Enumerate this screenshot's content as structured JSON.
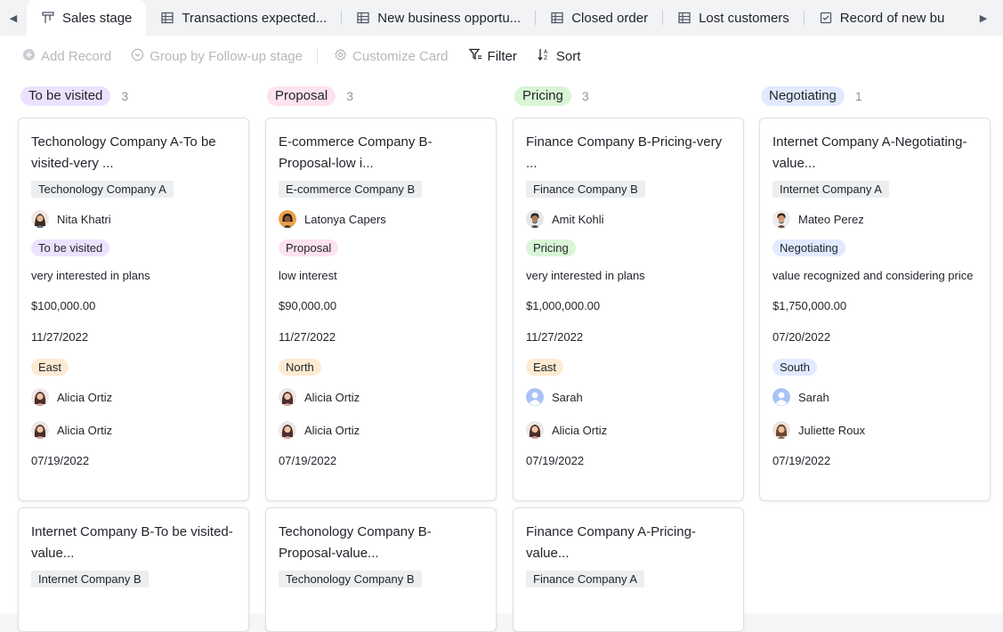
{
  "tabs": [
    {
      "label": "Sales stage",
      "icon": "kanban-icon",
      "active": true
    },
    {
      "label": "Transactions expected...",
      "icon": "grid-icon"
    },
    {
      "label": "New business opportu...",
      "icon": "grid-icon"
    },
    {
      "label": "Closed order",
      "icon": "grid-icon"
    },
    {
      "label": "Lost customers",
      "icon": "grid-icon"
    },
    {
      "label": "Record of new bu",
      "icon": "form-icon"
    }
  ],
  "toolbar": {
    "add_record": "Add Record",
    "group_by": "Group by Follow-up stage",
    "customize_card": "Customize Card",
    "filter": "Filter",
    "sort": "Sort"
  },
  "colors": {
    "visited": "#ece2fe",
    "proposal": "#fde2ef",
    "pricing": "#d9f5d6",
    "negotiating": "#e1eaff",
    "east": "#feead2",
    "north": "#feead2",
    "south": "#e1eaff"
  },
  "columns": [
    {
      "name": "To be visited",
      "count": "3",
      "color": "#ece2fe",
      "cards": [
        {
          "title": "Techonology Company A-To be visited-very ...",
          "company": "Techonology Company A",
          "contact": "Nita Khatri",
          "stage": "To be visited",
          "interest": "very interested in plans",
          "amount": "$100,000.00",
          "date1": "11/27/2022",
          "region": "East",
          "owner1": "Alicia Ortiz",
          "owner2": "Alicia Ortiz",
          "date2": "07/19/2022"
        },
        {
          "title": "Internet Company B-To be visited-value...",
          "company": "Internet Company B"
        }
      ]
    },
    {
      "name": "Proposal",
      "count": "3",
      "color": "#fde2ef",
      "cards": [
        {
          "title": "E-commerce Company B-Proposal-low i...",
          "company": "E-commerce Company B",
          "contact": "Latonya Capers",
          "stage": "Proposal",
          "interest": "low interest",
          "amount": "$90,000.00",
          "date1": "11/27/2022",
          "region": "North",
          "owner1": "Alicia Ortiz",
          "owner2": "Alicia Ortiz",
          "date2": "07/19/2022"
        },
        {
          "title": "Techonology Company B-Proposal-value...",
          "company": "Techonology Company B"
        }
      ]
    },
    {
      "name": "Pricing",
      "count": "3",
      "color": "#d9f5d6",
      "cards": [
        {
          "title": "Finance Company B-Pricing-very ...",
          "company": "Finance Company B",
          "contact": "Amit Kohli",
          "stage": "Pricing",
          "interest": "very interested in plans",
          "amount": "$1,000,000.00",
          "date1": "11/27/2022",
          "region": "East",
          "owner1": "Sarah",
          "owner2": "Alicia Ortiz",
          "date2": "07/19/2022"
        },
        {
          "title": "Finance Company A-Pricing-value...",
          "company": "Finance Company A"
        }
      ]
    },
    {
      "name": "Negotiating",
      "count": "1",
      "color": "#e1eaff",
      "cards": [
        {
          "title": "Internet Company A-Negotiating-value...",
          "company": "Internet Company A",
          "contact": "Mateo Perez",
          "stage": "Negotiating",
          "interest": "value recognized and considering price",
          "amount": "$1,750,000.00",
          "date1": "07/20/2022",
          "region": "South",
          "owner1": "Sarah",
          "owner2": "Juliette Roux",
          "date2": "07/19/2022"
        }
      ]
    }
  ]
}
